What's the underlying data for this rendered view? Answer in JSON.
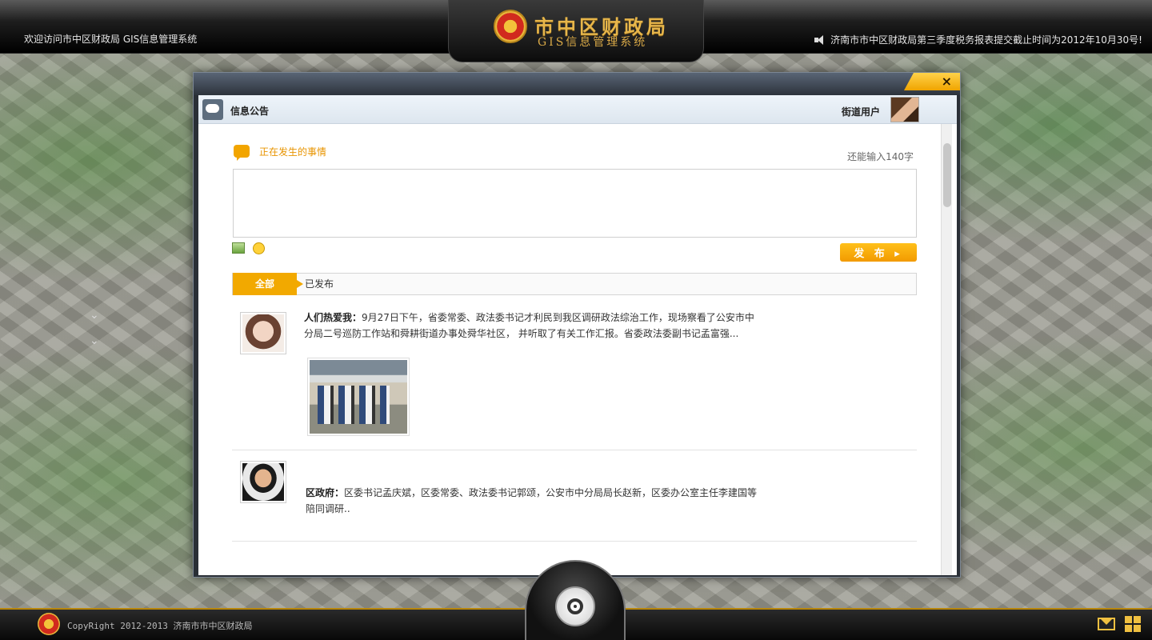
{
  "header": {
    "welcome_text": "欢迎访问市中区财政局 GIS信息管理系统",
    "logo_title": "市中区财政局",
    "logo_subtitle": "GIS信息管理系统",
    "notice_text": "济南市市中区财政局第三季度税务报表提交截止时间为2012年10月30号!"
  },
  "dialog": {
    "close_label": "×",
    "panel_title": "信息公告",
    "user_label": "街道用户"
  },
  "compose": {
    "title": "正在发生的事情",
    "char_count": "还能输入140字",
    "value": "",
    "publish_label": "发 布 ▸"
  },
  "tabs": {
    "all_label": "全部",
    "published_label": "已发布"
  },
  "posts": [
    {
      "author": "人们热爱我：",
      "text": "9月27日下午，省委常委、政法委书记才利民到我区调研政法综治工作，现场察看了公安市中分局二号巡防工作站和舜耕街道办事处舜华社区， 并听取了有关工作汇报。省委政法委副书记孟富强..."
    },
    {
      "author": "区政府：",
      "text": "区委书记孟庆斌，区委常委、政法委书记郭颂，公安市中分局局长赵新，区委办公室主任李建国等陪同调研.."
    }
  ],
  "footer": {
    "copyright": "CopyRight 2012-2013 济南市市中区财政局"
  },
  "colors": {
    "accent": "#f2a900",
    "header_bg": "#000000",
    "dialog_border": "#7c8794"
  }
}
